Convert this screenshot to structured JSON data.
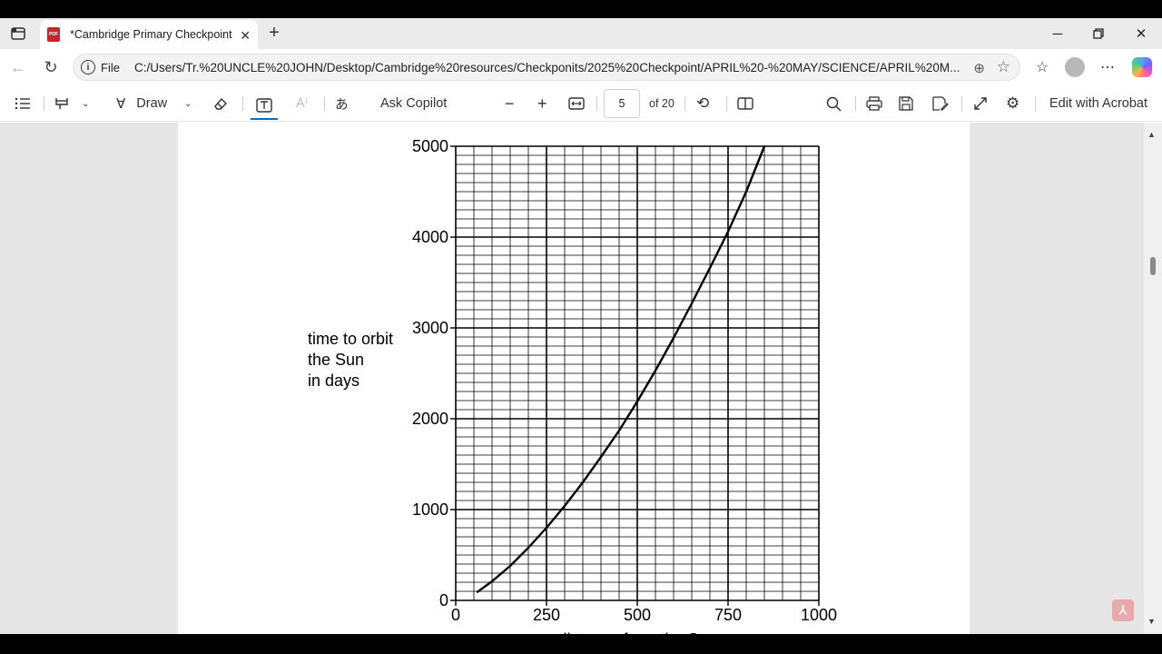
{
  "browser": {
    "tab": {
      "title": "*Cambridge Primary Checkpoint A",
      "icon": "pdf-file-icon"
    },
    "address": {
      "scheme": "File",
      "url": "C:/Users/Tr.%20UNCLE%20JOHN/Desktop/Cambridge%20resources/Checkponits/2025%20Checkpoint/APRIL%20-%20MAY/SCIENCE/APRIL%20M..."
    }
  },
  "pdf_toolbar": {
    "draw_label": "Draw",
    "ask_copilot_label": "Ask Copilot",
    "page_number": "5",
    "page_total": "of 20",
    "edit_acrobat_label": "Edit with Acrobat"
  },
  "chart_data": {
    "type": "line",
    "ylabel": "time to orbit\nthe Sun\nin days",
    "ylabel_lines": [
      "time to orbit",
      "the Sun",
      "in days"
    ],
    "xlabel": "distance from the Sun",
    "xlim": [
      0,
      1000
    ],
    "ylim": [
      0,
      5000
    ],
    "x_ticks": [
      "0",
      "250",
      "500",
      "750",
      "1000"
    ],
    "y_ticks": [
      "0",
      "1000",
      "2000",
      "3000",
      "4000",
      "5000"
    ],
    "grid": true,
    "series": [
      {
        "x": [
          58,
          100,
          150,
          200,
          250,
          300,
          350,
          400,
          450,
          500,
          550,
          600,
          650,
          700,
          750,
          800,
          850
        ],
        "y": [
          88,
          210,
          380,
          580,
          800,
          1040,
          1300,
          1580,
          1870,
          2190,
          2530,
          2890,
          3270,
          3660,
          4060,
          4500,
          5000
        ]
      }
    ]
  }
}
